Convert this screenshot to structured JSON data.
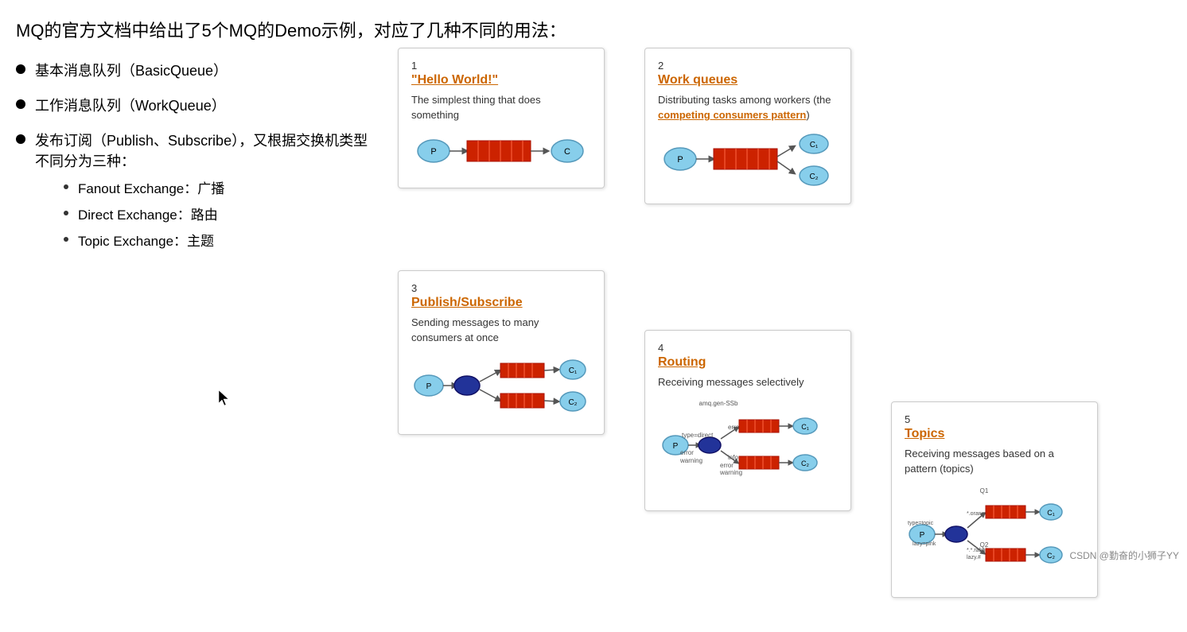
{
  "title": "MQ的官方文档中给出了5个MQ的Demo示例，对应了几种不同的用法：",
  "bullets": [
    {
      "text": "基本消息队列（BasicQueue）"
    },
    {
      "text": "工作消息队列（WorkQueue）"
    },
    {
      "text": "发布订阅（Publish、Subscribe），又根据交换机类型不同分为三种："
    }
  ],
  "subbullets": [
    {
      "text": "Fanout Exchange：广播"
    },
    {
      "text": "Direct Exchange：路由"
    },
    {
      "text": "Topic Exchange：主题"
    }
  ],
  "cards": [
    {
      "id": "card1",
      "number": "1",
      "title": "\"Hello World!\"",
      "desc": "The simplest thing that does something",
      "link": null
    },
    {
      "id": "card2",
      "number": "2",
      "title": "Work queues",
      "desc": "Distributing tasks among workers (the competing consumers pattern)",
      "link": "competing consumers pattern",
      "link_text": "competing consumers pattern"
    },
    {
      "id": "card3",
      "number": "3",
      "title": "Publish/Subscribe",
      "desc": "Sending messages to many consumers at once",
      "link": null
    },
    {
      "id": "card4",
      "number": "4",
      "title": "Routing",
      "desc": "Receiving messages selectively",
      "link": null
    },
    {
      "id": "card5",
      "number": "5",
      "title": "Topics",
      "desc": "Receiving messages based on a pattern (topics)",
      "link": null
    }
  ],
  "watermark": "CSDN @勤奋的小狮子YY"
}
